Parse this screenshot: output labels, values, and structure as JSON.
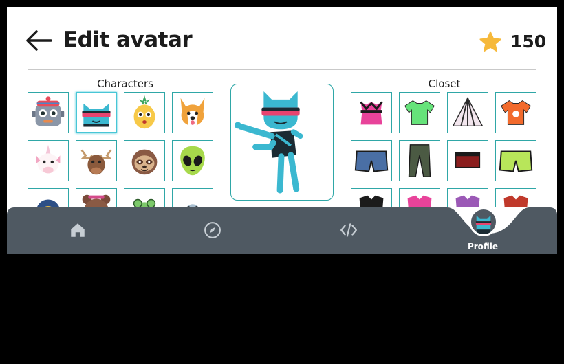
{
  "header": {
    "title": "Edit avatar",
    "back_icon": "arrow-left-icon",
    "stars": "150",
    "star_icon": "star-icon",
    "star_color": "#f6b93b"
  },
  "characters": {
    "label": "Characters",
    "items": [
      {
        "name": "robot"
      },
      {
        "name": "cat",
        "selected": true
      },
      {
        "name": "pineapple"
      },
      {
        "name": "corgi"
      },
      {
        "name": "unicorn"
      },
      {
        "name": "moose"
      },
      {
        "name": "sloth"
      },
      {
        "name": "alien"
      },
      {
        "name": "penguin"
      },
      {
        "name": "bear"
      },
      {
        "name": "frog"
      },
      {
        "name": "shark"
      }
    ]
  },
  "closet": {
    "label": "Closet",
    "items": [
      {
        "name": "pink-corset-top"
      },
      {
        "name": "green-tshirt"
      },
      {
        "name": "striped-cape"
      },
      {
        "name": "orange-tshirt"
      },
      {
        "name": "denim-shorts"
      },
      {
        "name": "camo-pants"
      },
      {
        "name": "red-skirt"
      },
      {
        "name": "green-shorts"
      },
      {
        "name": "black-top"
      },
      {
        "name": "pink-top"
      },
      {
        "name": "purple-top"
      },
      {
        "name": "red-top"
      }
    ]
  },
  "nav": {
    "items": [
      {
        "icon": "home-icon"
      },
      {
        "icon": "compass-icon"
      },
      {
        "icon": "code-icon"
      },
      {
        "icon": "profile-avatar-icon",
        "label": "Profile",
        "active": true
      }
    ],
    "bar_color": "#4f5962"
  },
  "accent_color": "#2fa7a7"
}
